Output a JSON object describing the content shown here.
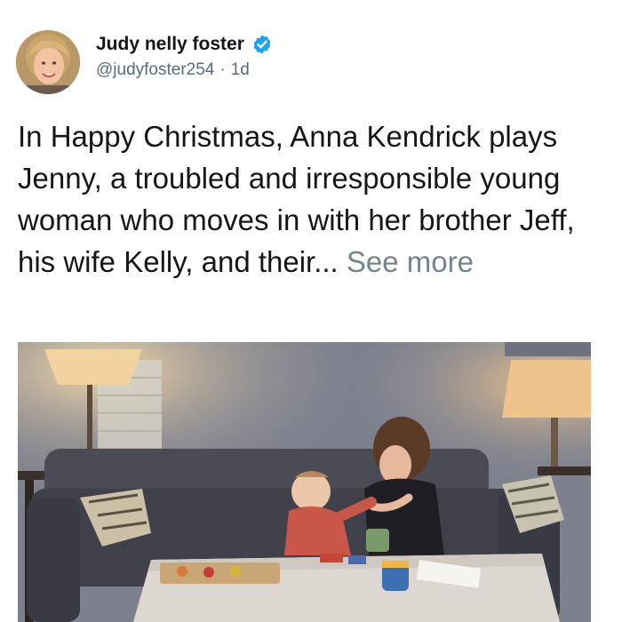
{
  "author": {
    "display_name": "Judy nelly foster",
    "handle": "@judyfoster254",
    "separator": "·",
    "age": "1d",
    "avatar_icon": "avatar-photo",
    "verified_icon": "verified-badge-icon",
    "verified_color": "#1da1f2"
  },
  "tweet": {
    "text": "In Happy Christmas, Anna Kendrick plays Jenny, a troubled and irresponsible young woman who moves in with her brother Jeff, his wife Kelly, and their...",
    "see_more": "See more"
  },
  "media": {
    "type": "photo"
  }
}
